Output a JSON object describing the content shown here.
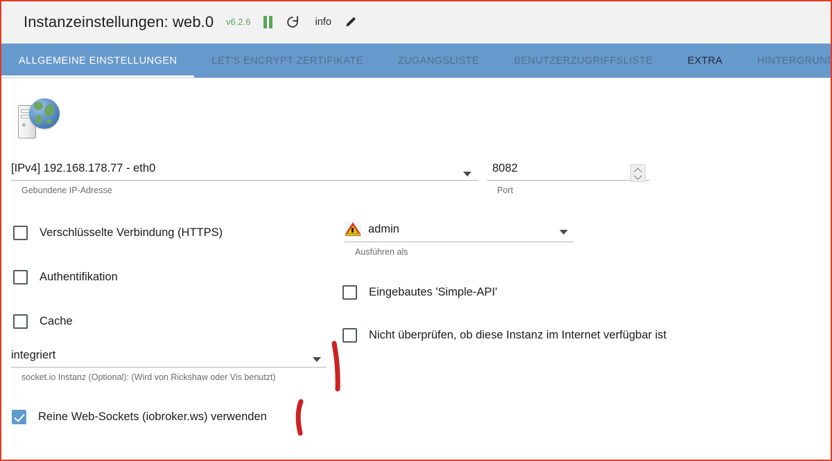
{
  "header": {
    "title": "Instanzeinstellungen: web.0",
    "version": "v6.2.6",
    "pause_icon": "pause-icon",
    "refresh_icon": "refresh-icon",
    "info_label": "info",
    "edit_icon": "pencil-icon"
  },
  "tabs": [
    {
      "label": "ALLGEMEINE EINSTELLUNGEN",
      "state": "active"
    },
    {
      "label": "LET'S ENCRYPT ZERTIFIKATE",
      "state": "normal"
    },
    {
      "label": "ZUGANGSLISTE",
      "state": "normal"
    },
    {
      "label": "BENUTZERZUGRIFFSLISTE",
      "state": "normal"
    },
    {
      "label": "EXTRA",
      "state": "hover"
    },
    {
      "label": "HINTERGRUND",
      "state": "normal"
    }
  ],
  "form": {
    "adapter_icon": "server-globe-icon",
    "ip": {
      "value": "[IPv4] 192.168.178.77 - eth0",
      "helper": "Gebundene IP-Adresse"
    },
    "port": {
      "value": "8082",
      "helper": "Port"
    },
    "run_as": {
      "value": "admin",
      "helper": "Ausführen als",
      "icon": "warning-triangle-icon"
    },
    "socket_io": {
      "value": "integriert",
      "helper": "socket.io Instanz (Optional): (Wird von Rickshaw oder Vis benutzt)"
    },
    "checkboxes": {
      "https": {
        "label": "Verschlüsselte Verbindung (HTTPS)",
        "checked": false
      },
      "auth": {
        "label": "Authentifikation",
        "checked": false
      },
      "cache": {
        "label": "Cache",
        "checked": false
      },
      "simple_api": {
        "label": "Eingebautes 'Simple-API'",
        "checked": false
      },
      "no_check": {
        "label": "Nicht überprüfen, ob diese Instanz im Internet verfügbar ist",
        "checked": false
      },
      "pure_ws": {
        "label": "Reine Web-Sockets (iobroker.ws) verwenden",
        "checked": true
      }
    }
  },
  "annotations": {
    "stroke_color": "#cc2222",
    "marks": [
      {
        "name": "mark-socket-io"
      },
      {
        "name": "mark-pure-websockets"
      }
    ]
  },
  "colors": {
    "tab_bar": "#6699cc",
    "accent_checkbox": "#5d9bd1",
    "version_green": "#5aa45a",
    "frame_red": "#e03a24"
  }
}
